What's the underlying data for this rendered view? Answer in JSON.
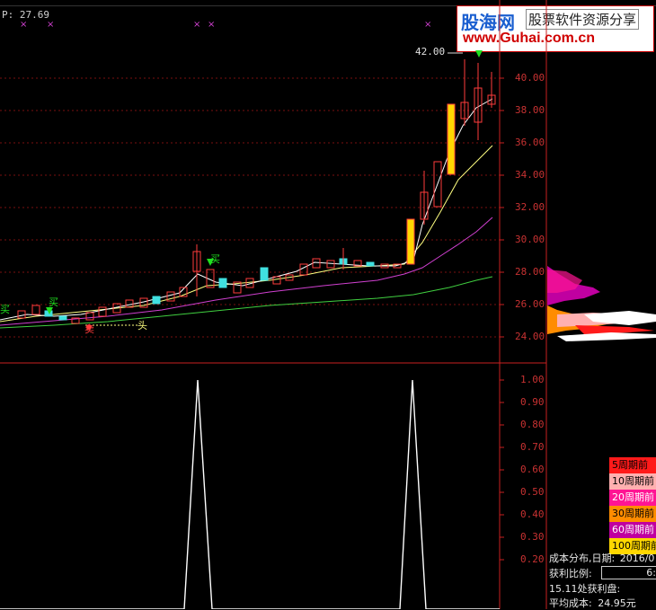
{
  "top_left_label": "P: 27.69",
  "watermark": {
    "logo_cn": "股海网",
    "slogan": "股票软件资源分享",
    "url": "www.Guhai.com.cn"
  },
  "price_axis": {
    "ticks": [
      "40.00",
      "38.00",
      "36.00",
      "34.00",
      "32.00",
      "30.00",
      "28.00",
      "26.00",
      "24.00"
    ]
  },
  "high_marker": "42.00",
  "candle_labels": {
    "buy": "买",
    "sell": "卖",
    "head": "头"
  },
  "sub_axis": {
    "ticks": [
      "1.00",
      "0.90",
      "0.80",
      "0.70",
      "0.60",
      "0.50",
      "0.40",
      "0.30",
      "0.20"
    ]
  },
  "legend": [
    {
      "label": "5周期前",
      "bg": "#ff1a1a",
      "fg": "#000000"
    },
    {
      "label": "10周期前",
      "bg": "#ffb0b0",
      "fg": "#000000"
    },
    {
      "label": "20周期前",
      "bg": "#ff1493",
      "fg": "#ffffff"
    },
    {
      "label": "30周期前",
      "bg": "#ff8c00",
      "fg": "#000000"
    },
    {
      "label": "60周期前",
      "bg": "#c000a0",
      "fg": "#ffffff"
    },
    {
      "label": "100周期前",
      "bg": "#ffd700",
      "fg": "#000000"
    }
  ],
  "info": {
    "cost_dist_label": "成本分布,日期:",
    "cost_dist_date": "2016/0",
    "profit_ratio_label": "获利比例:",
    "profit_ratio_value": "6:",
    "profit_at_label": "15.11处获利盘:",
    "avg_cost_label": "平均成本:",
    "avg_cost_value": "24.95元"
  },
  "colors": {
    "grid_line": "#7a1010",
    "axis_text": "#c83232",
    "ma5": "#ffffff",
    "ma10": "#ffff80",
    "ma30": "#d040d0",
    "ma60": "#40d040",
    "up_candle": "#ff3c3c",
    "down_candle": "#40e0e0",
    "limit_up": "#ffd700"
  }
}
